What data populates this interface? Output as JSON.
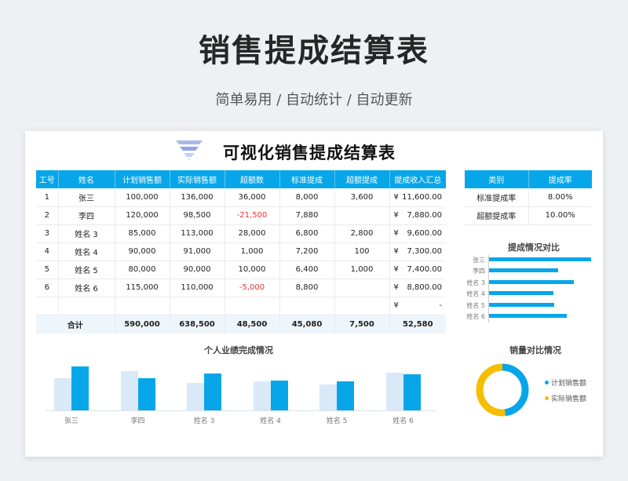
{
  "page": {
    "title": "销售提成结算表",
    "subtitle": "简单易用 / 自动统计 / 自动更新"
  },
  "card": {
    "title": "可视化销售提成结算表"
  },
  "main_table": {
    "headers": [
      "工号",
      "姓名",
      "计划销售额",
      "实际销售额",
      "超额数",
      "标准提成",
      "超额提成",
      "提成收入汇总"
    ],
    "currency_symbol": "¥",
    "rows": [
      {
        "id": "1",
        "name": "张三",
        "plan": "100,000",
        "actual": "136,000",
        "excess": "36,000",
        "std": "8,000",
        "extra": "3,600",
        "total": "11,600.00"
      },
      {
        "id": "2",
        "name": "李四",
        "plan": "120,000",
        "actual": "98,500",
        "excess": "-21,500",
        "std": "7,880",
        "extra": "",
        "total": "7,880.00"
      },
      {
        "id": "3",
        "name": "姓名 3",
        "plan": "85,000",
        "actual": "113,000",
        "excess": "28,000",
        "std": "6,800",
        "extra": "2,800",
        "total": "9,600.00"
      },
      {
        "id": "4",
        "name": "姓名 4",
        "plan": "90,000",
        "actual": "91,000",
        "excess": "1,000",
        "std": "7,200",
        "extra": "100",
        "total": "7,300.00"
      },
      {
        "id": "5",
        "name": "姓名 5",
        "plan": "80,000",
        "actual": "90,000",
        "excess": "10,000",
        "std": "6,400",
        "extra": "1,000",
        "total": "7,400.00"
      },
      {
        "id": "6",
        "name": "姓名 6",
        "plan": "115,000",
        "actual": "110,000",
        "excess": "-5,000",
        "std": "8,800",
        "extra": "",
        "total": "8,800.00"
      },
      {
        "id": "",
        "name": "",
        "plan": "",
        "actual": "",
        "excess": "",
        "std": "",
        "extra": "",
        "total": "-"
      }
    ],
    "totals": {
      "label": "合计",
      "plan": "590,000",
      "actual": "638,500",
      "excess": "48,500",
      "std": "45,080",
      "extra": "7,500",
      "total": "52,580"
    }
  },
  "rate_table": {
    "headers": [
      "类别",
      "提成率"
    ],
    "rows": [
      {
        "category": "标准提成率",
        "rate": "8.00%"
      },
      {
        "category": "超额提成率",
        "rate": "10.00%"
      }
    ]
  },
  "colors": {
    "accent": "#07a6e9",
    "plan_bar": "#d9e9f7",
    "donut_secondary": "#f6be00",
    "negative": "#e83535"
  },
  "chart_data": [
    {
      "type": "bar",
      "orientation": "horizontal",
      "title": "提成情况对比",
      "categories": [
        "张三",
        "李四",
        "姓名 3",
        "姓名 4",
        "姓名 5",
        "姓名 6"
      ],
      "values": [
        11600,
        7880,
        9600,
        7300,
        7400,
        8800
      ]
    },
    {
      "type": "bar",
      "title": "个人业绩完成情况",
      "categories": [
        "张三",
        "李四",
        "姓名 3",
        "姓名 4",
        "姓名 5",
        "姓名 6"
      ],
      "series": [
        {
          "values": [
            100000,
            120000,
            85000,
            90000,
            80000,
            115000
          ]
        },
        {
          "values": [
            136000,
            98500,
            113000,
            91000,
            90000,
            110000
          ]
        }
      ]
    },
    {
      "type": "pie",
      "title": "销量对比情况",
      "categories": [
        "计划销售额",
        "实际销售额"
      ],
      "values": [
        590000,
        638500
      ],
      "donut": true
    }
  ]
}
